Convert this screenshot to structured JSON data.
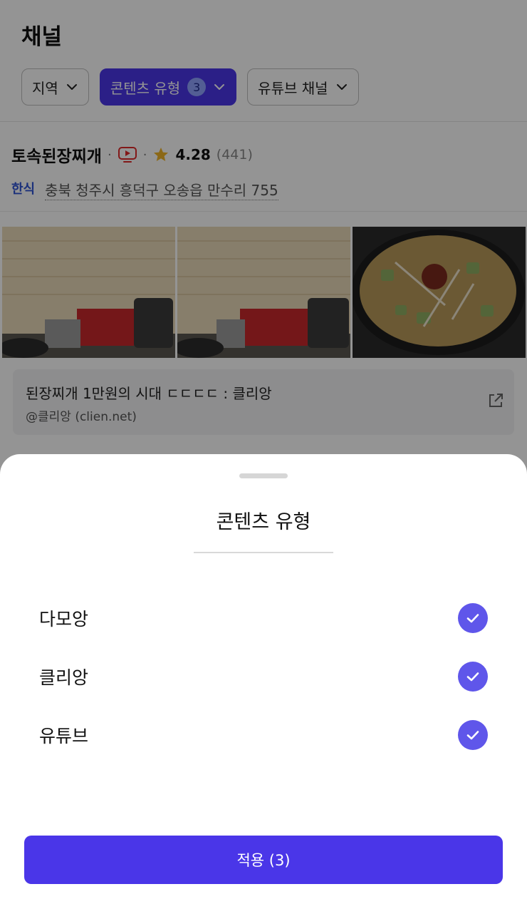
{
  "header": {
    "title": "채널"
  },
  "filters": [
    {
      "label": "지역",
      "active": false
    },
    {
      "label": "콘텐츠 유형",
      "count": "3",
      "active": true
    },
    {
      "label": "유튜브 채널",
      "active": false
    }
  ],
  "place": {
    "name": "토속된장찌개",
    "rating": "4.28",
    "review_count": "(441)",
    "category": "한식",
    "address": "충북 청주시 흥덕구 오송읍 만수리 755"
  },
  "post": {
    "title": "된장찌개 1만원의 시대 ㄷㄷㄷㄷ : 클리앙",
    "source": "@클리앙 (clien.net)"
  },
  "sheet": {
    "title": "콘텐츠 유형",
    "options": [
      {
        "label": "다모앙",
        "checked": true
      },
      {
        "label": "클리앙",
        "checked": true
      },
      {
        "label": "유튜브",
        "checked": true
      }
    ],
    "apply_label": "적용 (3)"
  },
  "colors": {
    "accent": "#4a36e8",
    "check": "#5f56ea",
    "category": "#2f54d4"
  },
  "icons": {
    "youtube": "youtube-icon",
    "star": "star-icon",
    "external": "external-link-icon",
    "chevron": "chevron-down-icon",
    "check": "check-icon"
  }
}
